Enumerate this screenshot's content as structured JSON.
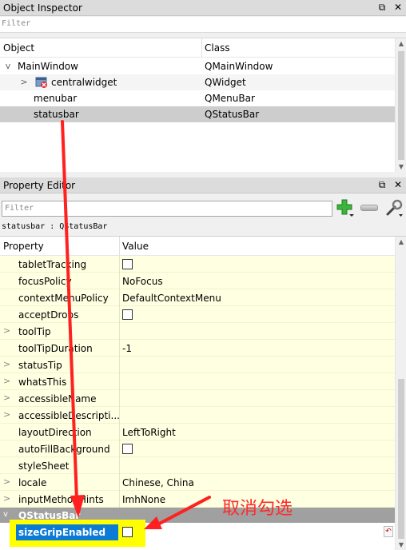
{
  "object_inspector": {
    "title": "Object Inspector",
    "filter_placeholder": "Filter",
    "columns": {
      "object": "Object",
      "class": "Class"
    },
    "rows": [
      {
        "name": "MainWindow",
        "class": "QMainWindow",
        "expanded": "v"
      },
      {
        "name": "centralwidget",
        "class": "QWidget",
        "expanded": ">"
      },
      {
        "name": "menubar",
        "class": "QMenuBar"
      },
      {
        "name": "statusbar",
        "class": "QStatusBar"
      }
    ]
  },
  "property_editor": {
    "title": "Property Editor",
    "filter_placeholder": "Filter",
    "object_label": "statusbar : QStatusBar",
    "columns": {
      "property": "Property",
      "value": "Value"
    },
    "rows": [
      {
        "name": "tabletTracking",
        "value": ""
      },
      {
        "name": "focusPolicy",
        "value": "NoFocus"
      },
      {
        "name": "contextMenuPolicy",
        "value": "DefaultContextMenu"
      },
      {
        "name": "acceptDrops",
        "value": ""
      },
      {
        "name": "toolTip",
        "value": ""
      },
      {
        "name": "toolTipDuration",
        "value": "-1"
      },
      {
        "name": "statusTip",
        "value": ""
      },
      {
        "name": "whatsThis",
        "value": ""
      },
      {
        "name": "accessibleName",
        "value": ""
      },
      {
        "name": "accessibleDescripti...",
        "value": ""
      },
      {
        "name": "layoutDirection",
        "value": "LeftToRight"
      },
      {
        "name": "autoFillBackground",
        "value": ""
      },
      {
        "name": "styleSheet",
        "value": ""
      },
      {
        "name": "locale",
        "value": "Chinese, China"
      },
      {
        "name": "inputMethodHints",
        "value": "ImhNone"
      }
    ],
    "group": "QStatusBar",
    "highlight_property": "sizeGripEnabled"
  },
  "annotation": {
    "text": "取消勾选",
    "color": "#ff2a2a"
  },
  "icons": {
    "arrow_expanded": "v",
    "arrow_collapsed": ">",
    "dock_float": "⧉",
    "dock_close": "✕",
    "reset": "↶"
  }
}
